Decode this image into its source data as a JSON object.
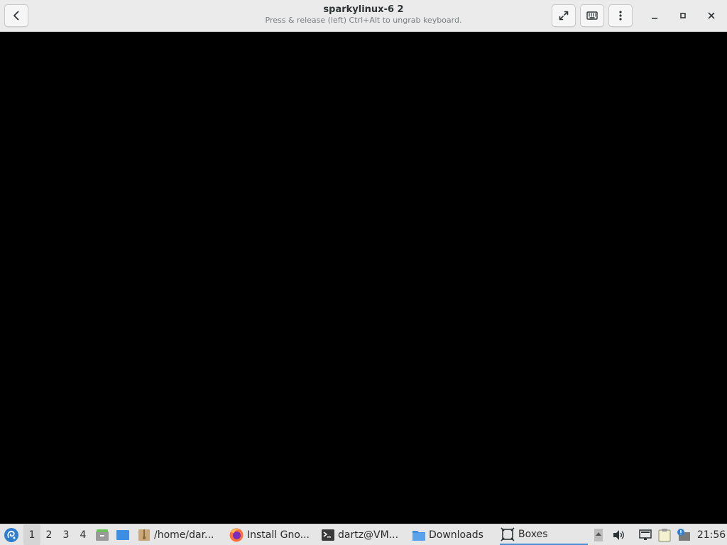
{
  "window": {
    "title": "sparkylinux-6 2",
    "subtitle": "Press & release (left) Ctrl+Alt to ungrab keyboard."
  },
  "header_buttons": {
    "back_icon": "back-arrow-icon",
    "fullscreen_icon": "fullscreen-icon",
    "keyboard_icon": "keyboard-icon",
    "menu_icon": "vertical-dots-menu-icon",
    "minimize_icon": "minimize-icon",
    "maximize_icon": "maximize-icon",
    "close_icon": "close-icon"
  },
  "taskbar": {
    "start_icon": "sparky-menu-icon",
    "desktops": [
      "1",
      "2",
      "3",
      "4"
    ],
    "active_desktop": "1",
    "launchers": [
      "file-manager-icon",
      "show-desktop-icon"
    ],
    "tasks": [
      {
        "label": "/home/dar...",
        "icon": "archive-icon",
        "active": false
      },
      {
        "label": "Install Gno...",
        "icon": "firefox-icon",
        "active": false
      },
      {
        "label": "dartz@VM...",
        "icon": "terminal-icon",
        "active": false
      },
      {
        "label": "Downloads",
        "icon": "folder-icon",
        "active": false
      },
      {
        "label": "Boxes",
        "icon": "boxes-icon",
        "active": true
      }
    ],
    "tray_icons": [
      "tray-up-arrow-icon",
      "volume-icon",
      "network-icon",
      "clipboard-icon",
      "update-notifier-icon"
    ],
    "clock": "21:56"
  },
  "colors": {
    "headerbar_bg": "#ebebeb",
    "display_bg": "#000000",
    "taskbar_bg": "#e6e6e6",
    "active_task_underline": "#4a90d9"
  }
}
